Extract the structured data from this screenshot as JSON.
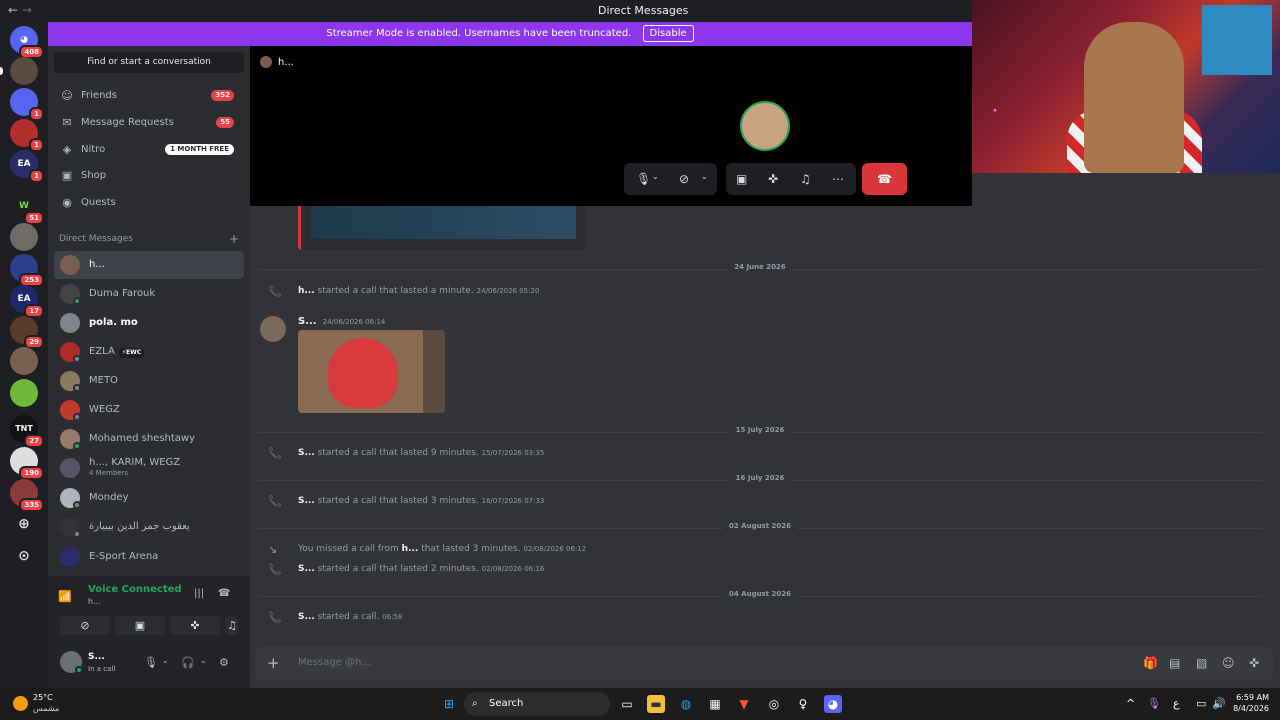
{
  "window": {
    "title": "Direct Messages",
    "nav_back": "←",
    "nav_forward": "→"
  },
  "banner": {
    "text": "Streamer Mode is enabled. Usernames have been truncated.",
    "button": "Disable"
  },
  "guilds": [
    {
      "label": "",
      "badge": "408"
    },
    {
      "label": "",
      "badge": ""
    },
    {
      "label": "",
      "badge": "1"
    },
    {
      "label": "",
      "badge": "1"
    },
    {
      "label": "EA",
      "badge": "1"
    },
    {
      "label": "W",
      "badge": "51"
    },
    {
      "label": "",
      "badge": ""
    },
    {
      "label": "",
      "badge": "253"
    },
    {
      "label": "EA",
      "badge": "17"
    },
    {
      "label": "",
      "badge": "29"
    },
    {
      "label": "",
      "badge": ""
    },
    {
      "label": "",
      "badge": ""
    },
    {
      "label": "TNT",
      "badge": "27"
    },
    {
      "label": "",
      "badge": "190"
    },
    {
      "label": "",
      "badge": "335"
    }
  ],
  "sidebar": {
    "search": "Find or start a conversation",
    "nav": [
      {
        "label": "Friends",
        "count": "352"
      },
      {
        "label": "Message Requests",
        "count": "55"
      },
      {
        "label": "Nitro",
        "promo": "1 MONTH FREE"
      },
      {
        "label": "Shop"
      },
      {
        "label": "Quests"
      }
    ],
    "dm_header": "Direct Messages",
    "dms": [
      {
        "name": "h...",
        "sub": "",
        "tag": ""
      },
      {
        "name": "Duma Farouk",
        "sub": "",
        "tag": ""
      },
      {
        "name": "pola. mo",
        "sub": "",
        "tag": ""
      },
      {
        "name": "EZLA",
        "sub": "",
        "tag": "EWC"
      },
      {
        "name": "METO",
        "sub": "",
        "tag": ""
      },
      {
        "name": "WEGZ",
        "sub": "",
        "tag": ""
      },
      {
        "name": "Mohamed sheshtawy",
        "sub": "",
        "tag": ""
      },
      {
        "name": "h..., KARIM, WEGZ",
        "sub": "4 Members",
        "tag": ""
      },
      {
        "name": "Mondey",
        "sub": "",
        "tag": ""
      },
      {
        "name": "يعقوب جمر الدين بيبيارة",
        "sub": "",
        "tag": ""
      },
      {
        "name": "E-Sport Arena",
        "sub": "",
        "tag": ""
      }
    ]
  },
  "voice": {
    "status": "Voice Connected",
    "channel": "h..."
  },
  "user": {
    "name": "S...",
    "status": "In a call"
  },
  "call": {
    "participant": "h..."
  },
  "chat": {
    "dividers": [
      "24 June 2026",
      "15 July 2026",
      "16 July 2026",
      "02 August 2026",
      "04 August 2026"
    ],
    "events": [
      {
        "user": "h...",
        "text": "started a call that lasted a minute.",
        "ts": "24/06/2026 05:20"
      },
      {
        "user": "S...",
        "text": "started a call that lasted 9 minutes.",
        "ts": "15/07/2026 03:35"
      },
      {
        "user": "S...",
        "text": "started a call that lasted 3 minutes.",
        "ts": "16/07/2026 07:33"
      },
      {
        "pre": "You missed a call from",
        "user": "h...",
        "text": "that lasted 3 minutes.",
        "ts": "02/08/2026 06:12"
      },
      {
        "user": "S...",
        "text": "started a call that lasted 2 minutes.",
        "ts": "02/08/2026 06:16"
      },
      {
        "user": "S...",
        "text": "started a call.",
        "ts": "06:58"
      }
    ],
    "post": {
      "user": "S...",
      "ts": "24/06/2026 06:14"
    }
  },
  "composer": {
    "placeholder": "Message @h..."
  },
  "taskbar": {
    "temp": "25°C",
    "condition": "مشمس",
    "search": "Search",
    "lang": "ع",
    "time": "6:59 AM",
    "date": "8/4/2026"
  },
  "colors": {
    "accent": "#5865f2",
    "online": "#23a55a",
    "danger": "#da373c",
    "streamer": "#8e35ee"
  }
}
